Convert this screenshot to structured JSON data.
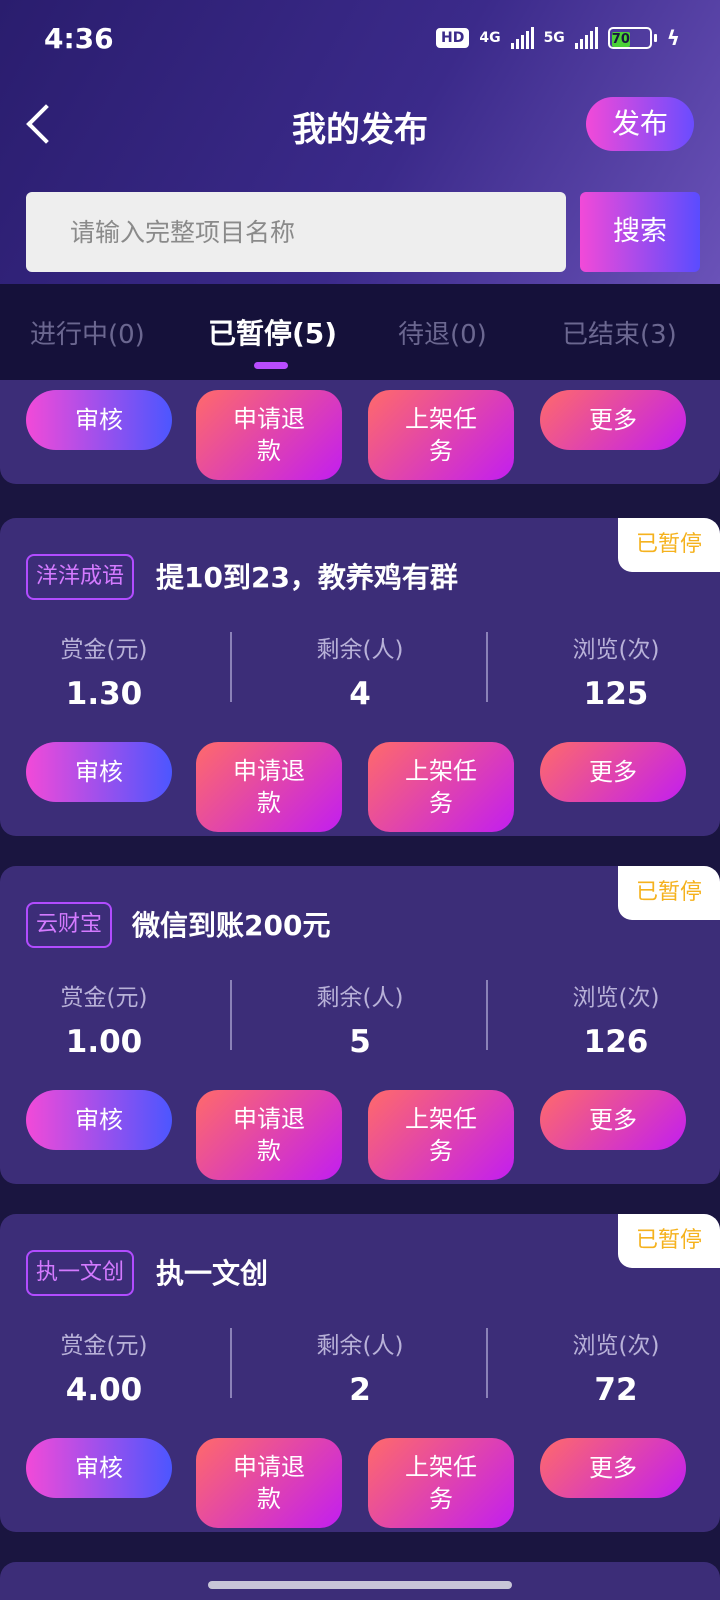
{
  "status_bar": {
    "time": "4:36",
    "hd": "HD",
    "net1": "4G",
    "net2": "5G",
    "battery": "70"
  },
  "header": {
    "title": "我的发布",
    "publish_label": "发布"
  },
  "search": {
    "placeholder": "请输入完整项目名称",
    "button_label": "搜索"
  },
  "tabs": [
    {
      "label": "进行中(0)"
    },
    {
      "label": "已暂停(5)"
    },
    {
      "label": "待退(0)"
    },
    {
      "label": "已结束(3)"
    }
  ],
  "active_tab": 1,
  "stat_labels": {
    "reward": "赏金(元)",
    "remaining": "剩余(人)",
    "views": "浏览(次)"
  },
  "actions": {
    "review": "审核",
    "refund_line1": "申请退",
    "refund_line2": "款",
    "list_line1": "上架任",
    "list_line2": "务",
    "more": "更多"
  },
  "tasks": [
    {
      "status": "已暂停",
      "source": "洋洋成语",
      "name": "提10到23，教养鸡有群",
      "reward": "1.30",
      "remaining": "4",
      "views": "125"
    },
    {
      "status": "已暂停",
      "source": "云财宝",
      "name": "微信到账200元",
      "reward": "1.00",
      "remaining": "5",
      "views": "126"
    },
    {
      "status": "已暂停",
      "source": "执一文创",
      "name": "执一文创",
      "reward": "4.00",
      "remaining": "2",
      "views": "72"
    }
  ],
  "colors": {
    "accent_gradient_start": "#f24ad8",
    "accent_gradient_end": "#4c56ff",
    "status_paused": "#f5b21e",
    "card_bg": "#3c2d78"
  }
}
